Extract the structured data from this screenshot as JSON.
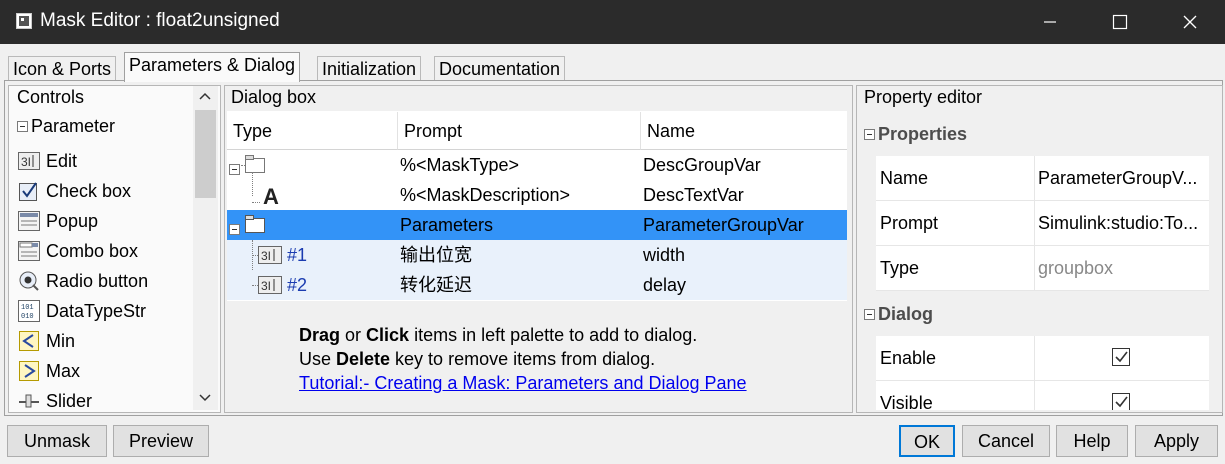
{
  "window": {
    "title": "Mask Editor : float2unsigned"
  },
  "tabs": [
    {
      "label": "Icon & Ports"
    },
    {
      "label": "Parameters & Dialog",
      "active": true
    },
    {
      "label": "Initialization"
    },
    {
      "label": "Documentation"
    }
  ],
  "controls": {
    "header": "Controls",
    "group": "Parameter",
    "items": [
      {
        "label": "Edit",
        "icon": "edit-icon"
      },
      {
        "label": "Check box",
        "icon": "checkbox-icon"
      },
      {
        "label": "Popup",
        "icon": "popup-icon"
      },
      {
        "label": "Combo box",
        "icon": "combobox-icon"
      },
      {
        "label": "Radio button",
        "icon": "radio-icon"
      },
      {
        "label": "DataTypeStr",
        "icon": "datatype-icon"
      },
      {
        "label": "Min",
        "icon": "min-icon"
      },
      {
        "label": "Max",
        "icon": "max-icon"
      },
      {
        "label": "Slider",
        "icon": "slider-icon"
      }
    ]
  },
  "dialog_box": {
    "header": "Dialog box",
    "columns": [
      "Type",
      "Prompt",
      "Name"
    ],
    "rows": [
      {
        "type": "",
        "prompt": "%<MaskType>",
        "name": "DescGroupVar",
        "icon": "group-icon"
      },
      {
        "type": "",
        "prompt": "%<MaskDescription>",
        "name": "DescTextVar",
        "icon": "text-icon"
      },
      {
        "type": "",
        "prompt": "Parameters",
        "name": "ParameterGroupVar",
        "icon": "group-icon",
        "selected": true
      },
      {
        "type": "#1",
        "prompt": "输出位宽",
        "name": "width",
        "icon": "edit-icon"
      },
      {
        "type": "#2",
        "prompt": "转化延迟",
        "name": "delay",
        "icon": "edit-icon"
      }
    ],
    "hint": {
      "line1_b1": "Drag",
      "line1_t1": " or ",
      "line1_b2": "Click",
      "line1_t2": " items in left palette to add to dialog.",
      "line2_t1": "Use ",
      "line2_b1": "Delete",
      "line2_t2": " key to remove items from dialog.",
      "link": "Tutorial:- Creating a Mask: Parameters and Dialog Pane"
    }
  },
  "property_editor": {
    "header": "Property editor",
    "sections": {
      "properties": "Properties",
      "dialog": "Dialog"
    },
    "properties": [
      {
        "key": "Name",
        "value": "ParameterGroupV..."
      },
      {
        "key": "Prompt",
        "value": "Simulink:studio:To..."
      },
      {
        "key": "Type",
        "value": "groupbox"
      }
    ],
    "dialog": [
      {
        "key": "Enable",
        "checked": true
      },
      {
        "key": "Visible",
        "checked": true
      }
    ]
  },
  "buttons": {
    "unmask": "Unmask",
    "preview": "Preview",
    "ok": "OK",
    "cancel": "Cancel",
    "help": "Help",
    "apply": "Apply"
  },
  "colors": {
    "titlebar": "#2b2b2b",
    "selection": "#3393f7",
    "link": "#0000ee",
    "accent": "#0078d7"
  }
}
